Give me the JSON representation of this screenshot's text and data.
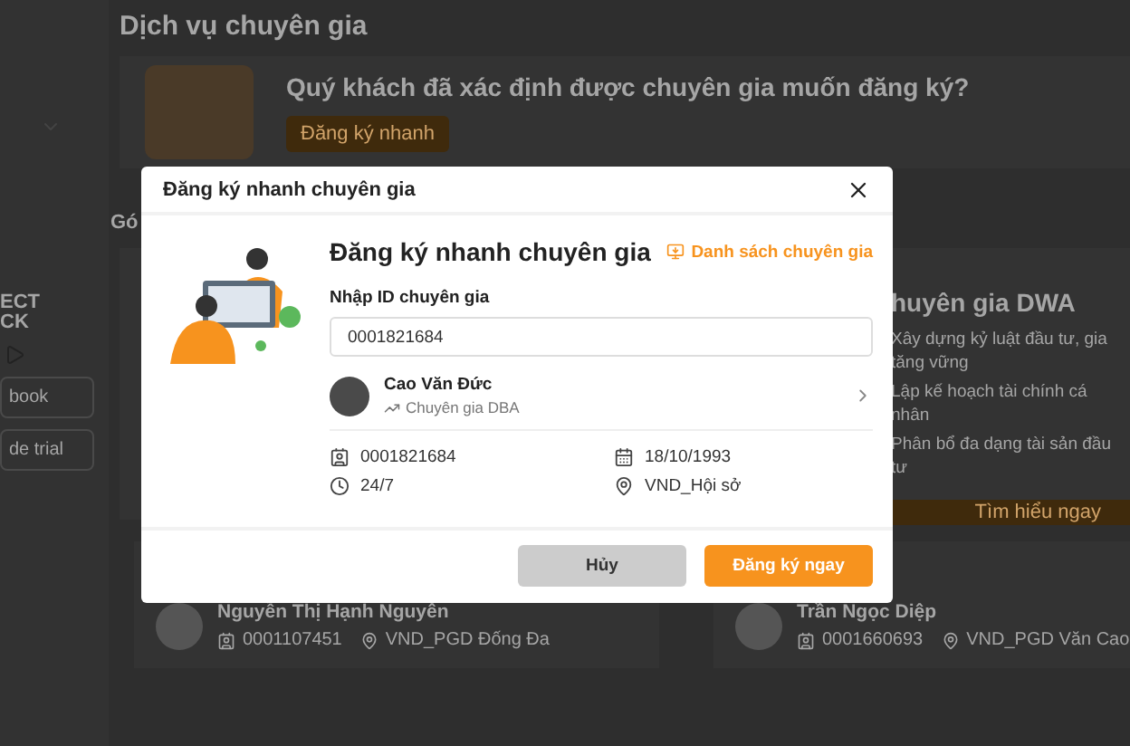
{
  "background": {
    "sidebar": {
      "app_label_lines": [
        "ECT",
        "CK"
      ],
      "buttons": [
        "book",
        "de trial"
      ]
    },
    "page_title": "Dịch vụ chuyên gia",
    "banner": {
      "question": "Quý khách đã xác định được chuyên gia muốn đăng ký?",
      "button": "Đăng ký nhanh"
    },
    "section_title": "Gó",
    "package": {
      "title": "huyên gia DWA",
      "bullets": [
        "Xây dựng kỷ luật đầu tư, gia tăng vững",
        "Lập kế hoạch tài chính cá nhân",
        "Phân bổ đa dạng tài sản đầu tư"
      ],
      "button": "Tìm hiểu ngay"
    },
    "experts": [
      {
        "name": "Nguyễn Thị Hạnh Nguyên",
        "id": "0001107451",
        "branch": "VND_PGD Đống Đa"
      },
      {
        "name": "Trần Ngọc Diệp",
        "id": "0001660693",
        "branch": "VND_PGD Văn Cao"
      }
    ]
  },
  "modal": {
    "title": "Đăng ký nhanh chuyên gia",
    "heading": "Đăng ký nhanh chuyên gia",
    "list_link": "Danh sách chuyên gia",
    "field": {
      "label": "Nhập ID chuyên gia",
      "value": "0001821684"
    },
    "expert": {
      "name": "Cao Văn Đức",
      "role": "Chuyên gia DBA"
    },
    "info": [
      {
        "kind": "id",
        "text": "0001821684"
      },
      {
        "kind": "date",
        "text": "18/10/1993"
      },
      {
        "kind": "time",
        "text": "24/7"
      },
      {
        "kind": "location",
        "text": "VND_Hội sở"
      }
    ],
    "buttons": [
      {
        "kind": "secondary",
        "label": "Hủy"
      },
      {
        "kind": "primary",
        "label": "Đăng ký ngay"
      }
    ]
  }
}
